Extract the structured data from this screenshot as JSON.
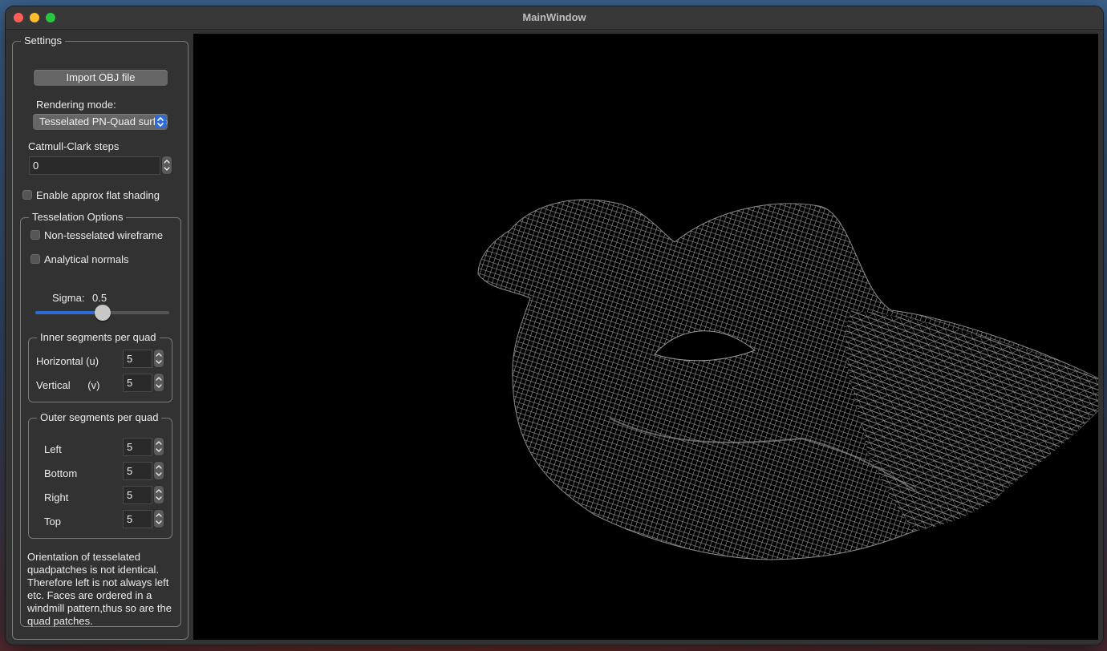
{
  "window": {
    "title": "MainWindow"
  },
  "settings": {
    "title": "Settings",
    "import_button": "Import OBJ file",
    "rendering_mode_label": "Rendering mode:",
    "rendering_mode_value": "Tesselated PN-Quad surface",
    "catmull_label": "Catmull-Clark steps",
    "catmull_value": "0",
    "flat_shading_label": "Enable approx flat shading",
    "flat_shading_checked": false
  },
  "tesselation": {
    "title": "Tesselation Options",
    "wireframe_label": "Non-tesselated wireframe",
    "wireframe_checked": false,
    "analytical_label": "Analytical normals",
    "analytical_checked": false,
    "sigma_label": "Sigma:",
    "sigma_value": "0.5",
    "sigma_fraction": 0.5,
    "inner": {
      "title": "Inner segments per quad",
      "horizontal_label": "Horizontal  (u)",
      "horizontal_value": "5",
      "vertical_label": "Vertical      (v)",
      "vertical_value": "5"
    },
    "outer": {
      "title": "Outer segments per quad",
      "left_label": "Left",
      "left_value": "5",
      "bottom_label": "Bottom",
      "bottom_value": "5",
      "right_label": "Right",
      "right_value": "5",
      "top_label": "Top",
      "top_value": "5"
    },
    "note": "Orientation of tesselated quadpatches is not identical. Therefore left is not always left etc. Faces are ordered in a windmill pattern,thus so are the quad patches."
  },
  "viewport": {
    "background": "#000000",
    "mesh_color": "#8a8a8a"
  },
  "colors": {
    "accent": "#2d6bd8"
  }
}
